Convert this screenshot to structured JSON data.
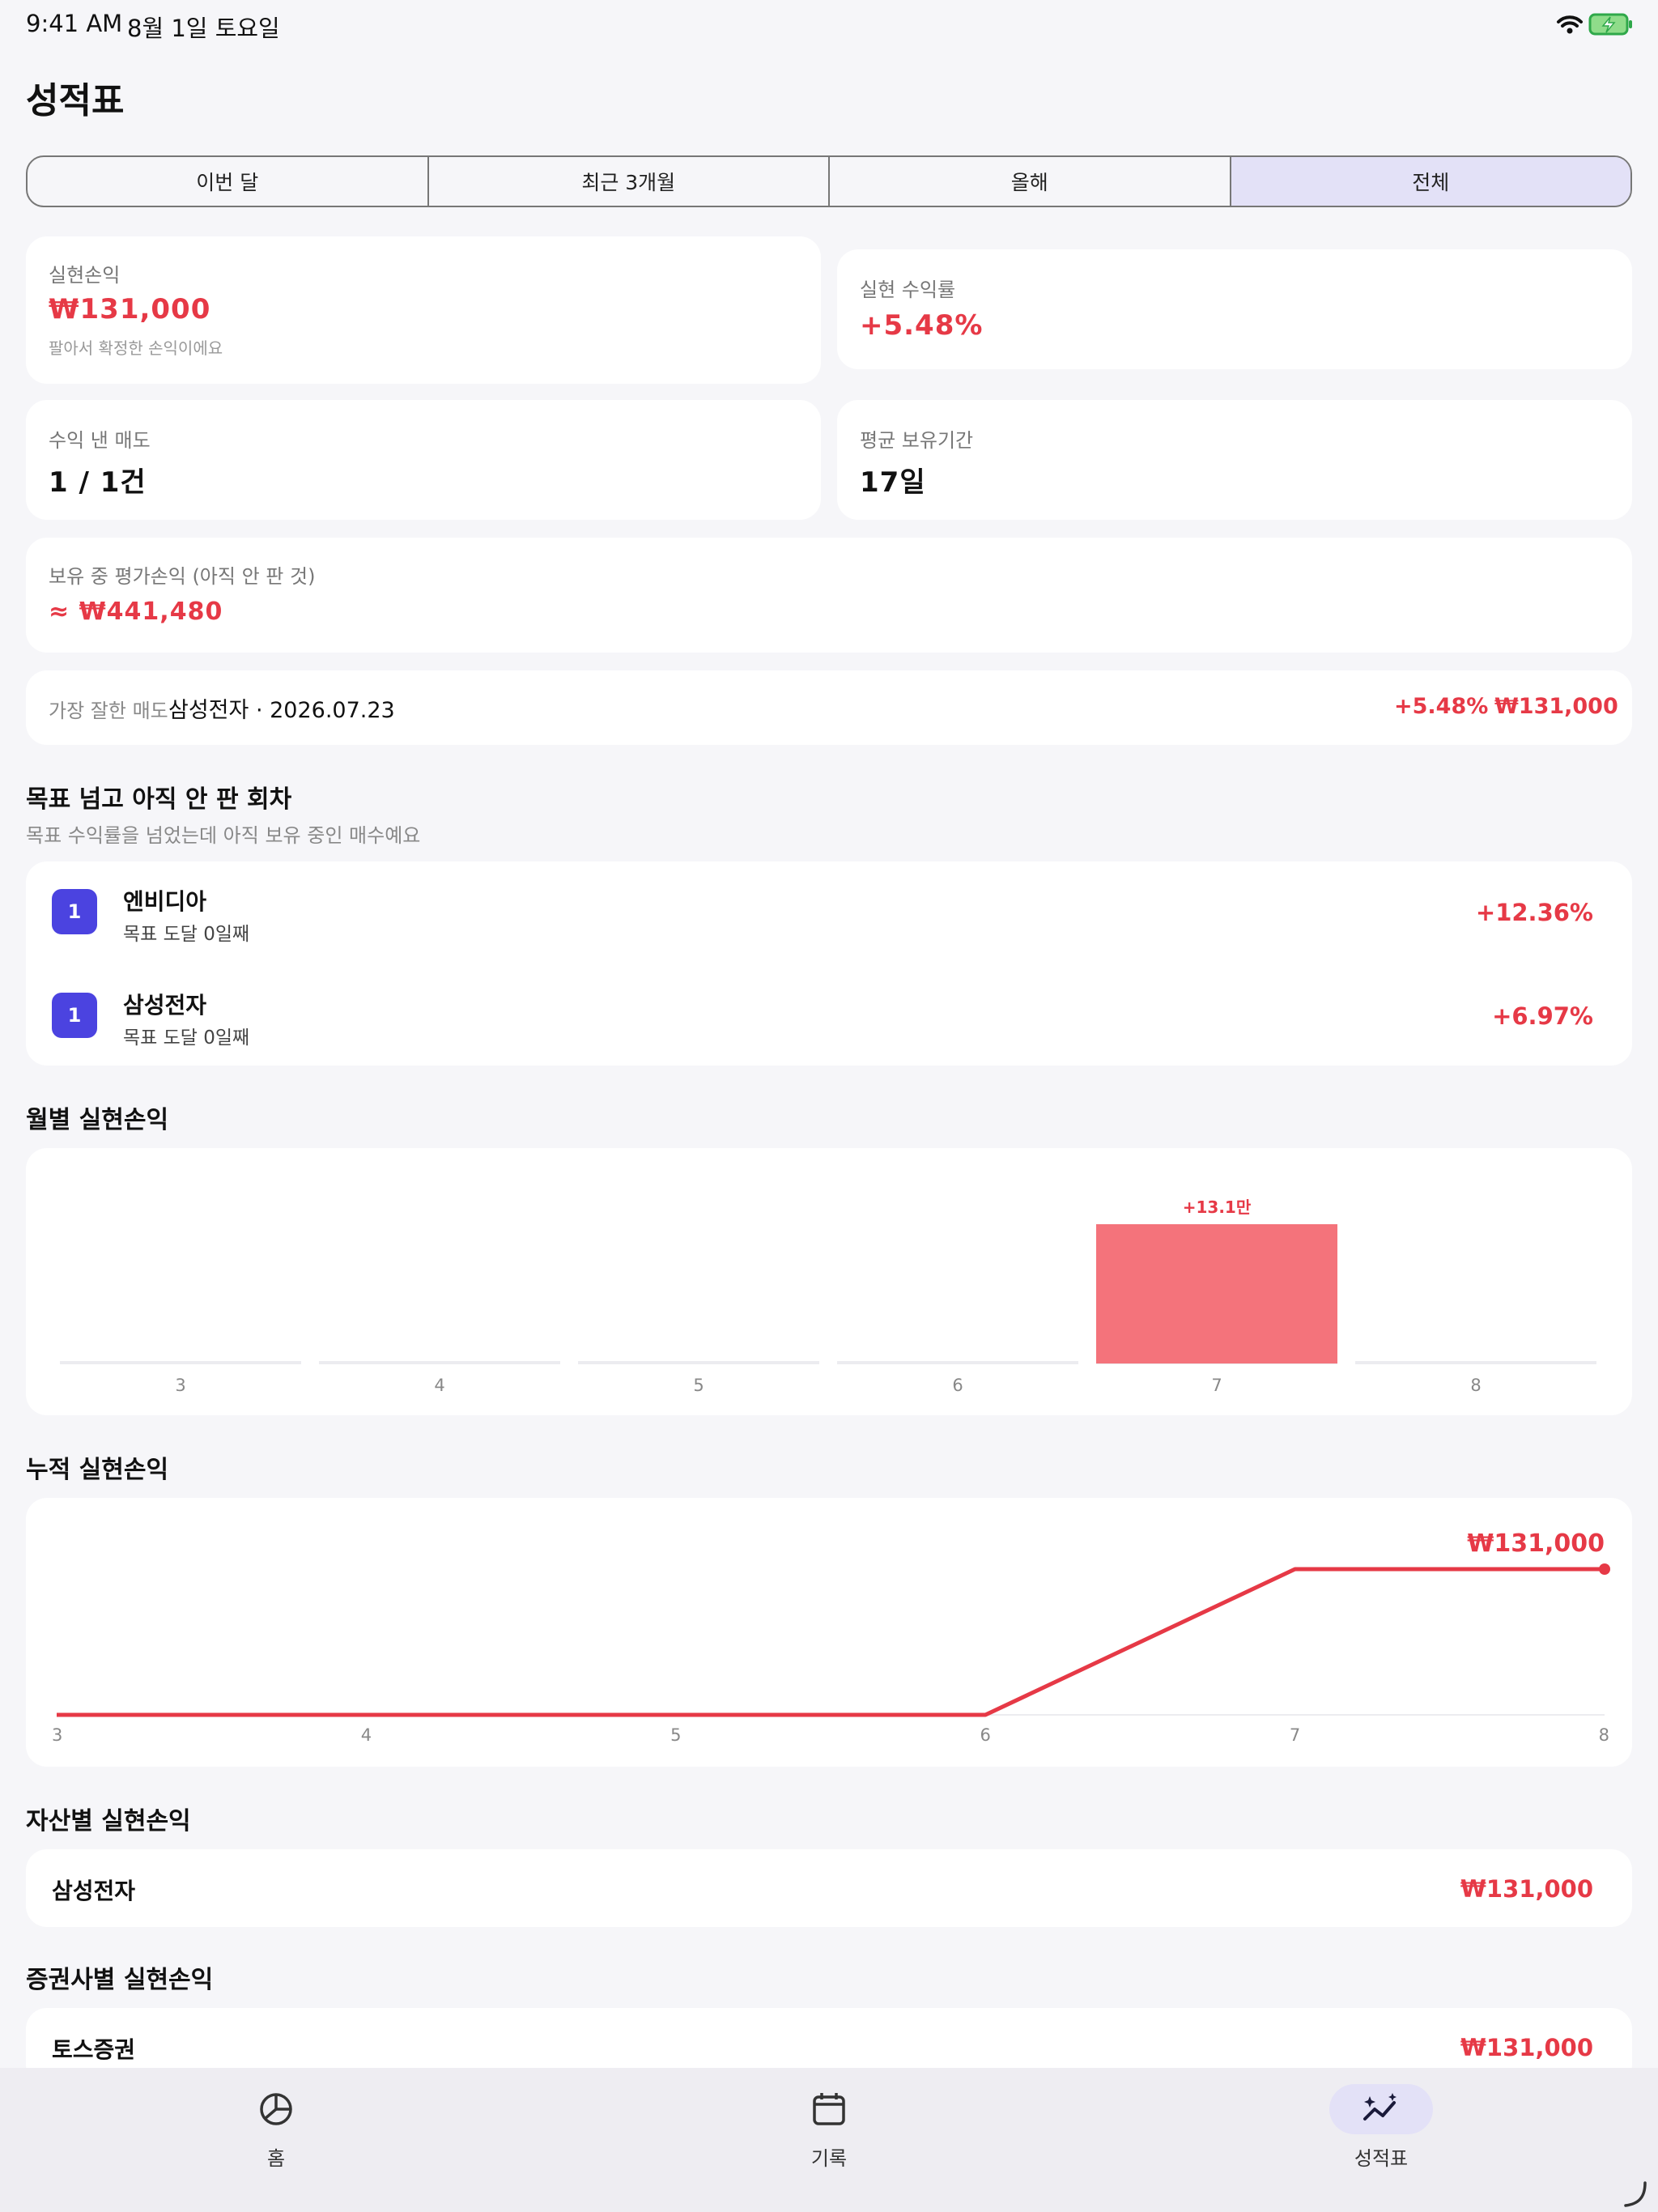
{
  "status": {
    "time": "9:41 AM",
    "date": "8월 1일 토요일"
  },
  "title": "성적표",
  "segments": [
    {
      "label": "이번 달",
      "active": false
    },
    {
      "label": "최근 3개월",
      "active": false
    },
    {
      "label": "올해",
      "active": false
    },
    {
      "label": "전체",
      "active": true
    }
  ],
  "stats": {
    "realized_label": "실현손익",
    "realized_value": "₩131,000",
    "realized_note": "팔아서 확정한 손익이에요",
    "rate_label": "실현 수익률",
    "rate_value": "+5.48%",
    "wins_label": "수익 낸 매도",
    "wins_value": "1 / 1건",
    "hold_label": "평균 보유기간",
    "hold_value": "17일",
    "unrealized_label": "보유 중 평가손익 (아직 안 판 것)",
    "unrealized_value": "≈ ₩441,480"
  },
  "best_sale": {
    "label": "가장 잘한 매도",
    "name": "삼성전자 · 2026.07.23",
    "rate": "+5.48%",
    "amount": "₩131,000"
  },
  "targets": {
    "title": "목표 넘고 아직 안 판 회차",
    "subtitle": "목표 수익률을 넘었는데 아직 보유 중인 매수예요",
    "items": [
      {
        "badge": "1",
        "name": "엔비디아",
        "sub": "목표 도달 0일째",
        "rate": "+12.36%"
      },
      {
        "badge": "1",
        "name": "삼성전자",
        "sub": "목표 도달 0일째",
        "rate": "+6.97%"
      }
    ]
  },
  "monthly_title": "월별 실현손익",
  "cumulative_title": "누적 실현손익",
  "chart_data": [
    {
      "type": "bar",
      "title": "월별 실현손익",
      "categories": [
        "3",
        "4",
        "5",
        "6",
        "7",
        "8"
      ],
      "values": [
        0,
        0,
        0,
        0,
        131000,
        0
      ],
      "data_labels": [
        "",
        "",
        "",
        "",
        "+13.1만",
        ""
      ],
      "color": "#f4737b"
    },
    {
      "type": "line",
      "title": "누적 실현손익",
      "x": [
        "3",
        "4",
        "5",
        "6",
        "7",
        "8"
      ],
      "values": [
        0,
        0,
        0,
        0,
        131000,
        131000
      ],
      "end_label": "₩131,000",
      "color": "#e63946"
    }
  ],
  "by_asset": {
    "title": "자산별 실현손익",
    "items": [
      {
        "name": "삼성전자",
        "value": "₩131,000"
      }
    ]
  },
  "by_broker": {
    "title": "증권사별 실현손익",
    "items": [
      {
        "name": "토스증권",
        "value": "₩131,000"
      }
    ]
  },
  "tabs": [
    {
      "label": "홈",
      "icon": "pie-chart-icon",
      "active": false
    },
    {
      "label": "기록",
      "icon": "calendar-icon",
      "active": false
    },
    {
      "label": "성적표",
      "icon": "sparkle-chart-icon",
      "active": true
    }
  ],
  "colors": {
    "accent": "#4b43e0",
    "red": "#e63946",
    "bar": "#f4737b",
    "segment_active": "#e3e1f7"
  }
}
